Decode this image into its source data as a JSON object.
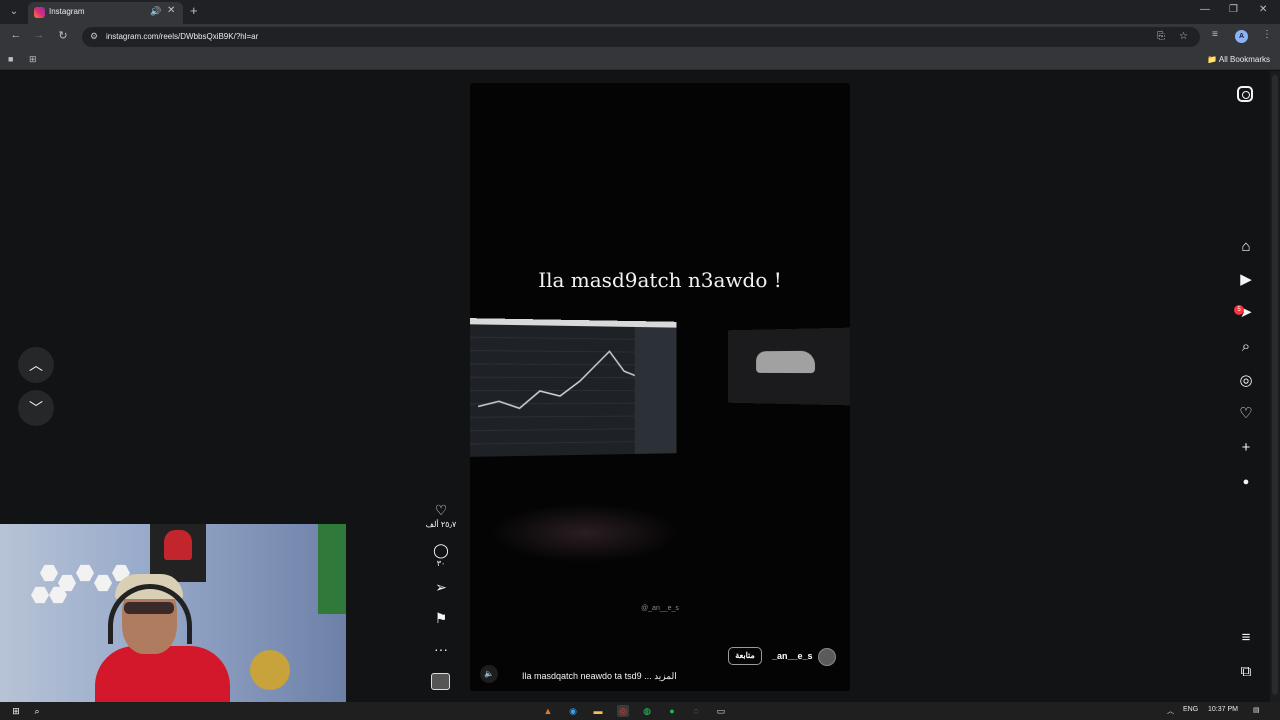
{
  "browser": {
    "tab_title": "Instagram",
    "url": "instagram.com/reels/DWbbsQxiB9K/?hl=ar",
    "all_bookmarks": "All Bookmarks",
    "profile_initial": "A"
  },
  "nav": {
    "notification_count": "5"
  },
  "reel": {
    "overlay_text": "Ila masd9atch n3awdo !",
    "watermark": "@_an__e_s",
    "description": "Ila masdqatch neawdo ta tsd9 ... المزيد",
    "username": "_an__e_s",
    "follow_label": "متابعة",
    "likes_count": "٢٥٫٧ ألف",
    "comments_count": "٣٠"
  },
  "taskbar": {
    "language": "ENG",
    "time": "10:37 PM"
  }
}
